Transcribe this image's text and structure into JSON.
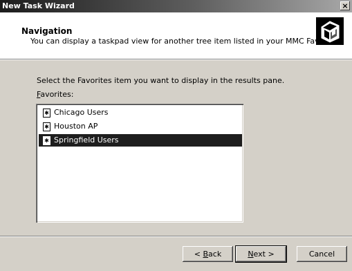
{
  "window": {
    "title": "New Task Wizard",
    "close_glyph": "×"
  },
  "header": {
    "title": "Navigation",
    "subtitle": "You can display a taskpad view for another tree item listed in your MMC Favorites.",
    "icon": "wizard-icon"
  },
  "body": {
    "instruction": "Select the Favorites item you want to display in the results pane.",
    "favorites_label_first": "F",
    "favorites_label_rest": "avorites:"
  },
  "favorites": {
    "items": [
      {
        "label": "Chicago Users",
        "icon": "document-star-icon"
      },
      {
        "label": "Houston AP",
        "icon": "document-star-icon"
      },
      {
        "label": "Springfield Users",
        "icon": "document-star-icon",
        "selected": true
      }
    ]
  },
  "buttons": {
    "back_prefix": "< ",
    "back_key": "B",
    "back_rest": "ack",
    "next_key": "N",
    "next_rest": "ext >",
    "cancel": "Cancel"
  }
}
